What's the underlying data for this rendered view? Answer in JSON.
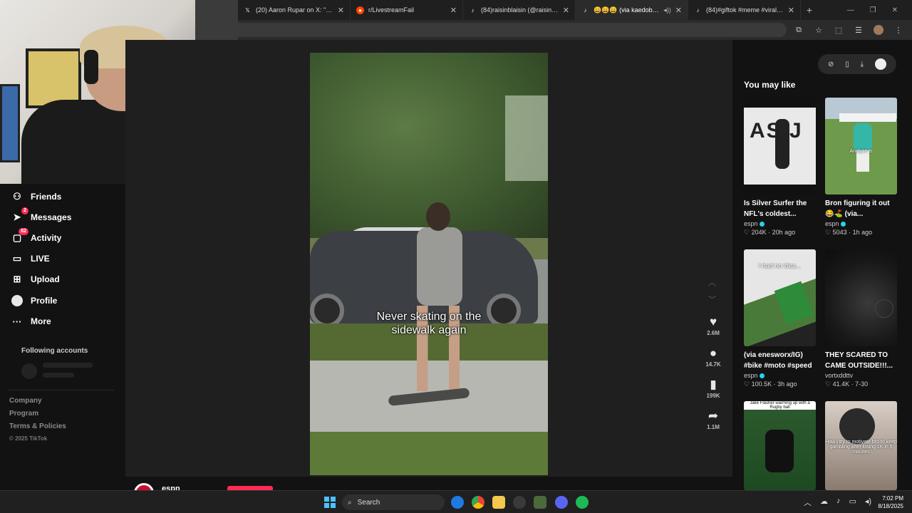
{
  "browser": {
    "tabs": [
      {
        "title": "(20) Aaron Rupar on X: \"Trump",
        "favicon": "x-logo-icon",
        "active": false
      },
      {
        "title": "r/LivestreamFail",
        "favicon": "reddit-icon",
        "active": false
      },
      {
        "title": "(84)raisinblaisin (@raisinblaisin",
        "favicon": "tiktok-icon",
        "active": false
      },
      {
        "title": "😄😄😄 (via kaedobrien/I",
        "favicon": "tiktok-icon",
        "active": true
      },
      {
        "title": "(84)#giftok #meme #viral #fun",
        "favicon": "tiktok-icon",
        "active": false
      }
    ],
    "new_tab": "+",
    "close_glyph": "✕"
  },
  "sidebar": {
    "items": [
      {
        "label": "Friends",
        "icon": "friends-icon"
      },
      {
        "label": "Messages",
        "icon": "messages-icon",
        "badge": "2"
      },
      {
        "label": "Activity",
        "icon": "activity-icon",
        "badge": "82"
      },
      {
        "label": "LIVE",
        "icon": "live-icon"
      },
      {
        "label": "Upload",
        "icon": "upload-icon"
      },
      {
        "label": "Profile",
        "icon": "profile-icon"
      },
      {
        "label": "More",
        "icon": "more-icon"
      }
    ],
    "following_title": "Following accounts",
    "footer_links": [
      "Company",
      "Program",
      "Terms & Policies"
    ],
    "copyright": "© 2025 TikTok"
  },
  "video": {
    "caption_line1": "Never skating on the",
    "caption_line2": "sidewalk again",
    "likes": "2.6M",
    "comments": "14.7K",
    "saves": "199K",
    "shares": "1.1M"
  },
  "bottom": {
    "author": "espn"
  },
  "recommendations": {
    "title": "You may like",
    "cards": [
      {
        "title": "Is Silver Surfer the NFL's coldest...",
        "author": "espn",
        "verified": true,
        "likes": "204K",
        "age": "20h ago",
        "overlay": ""
      },
      {
        "title": "Bron figuring it out 😂⛳ (via...",
        "author": "espn",
        "verified": true,
        "likes": "5043",
        "age": "1h ago",
        "overlay": "Analyze ts"
      },
      {
        "title": "(via enesworx/IG) #bike #moto #speed",
        "author": "espn",
        "verified": true,
        "likes": "100.5K",
        "age": "3h ago",
        "overlay": "I had no idea..."
      },
      {
        "title": "THEY SCARED TO CAME OUTSIDE!!!...",
        "author": "vortxddttv",
        "verified": false,
        "likes": "41.4K",
        "age": "7-30",
        "overlay": ""
      },
      {
        "title": "",
        "author": "",
        "verified": false,
        "likes": "",
        "age": "",
        "overlay": "Jake Flasher warming up with a Rugby ball"
      },
      {
        "title": "",
        "author": "",
        "verified": false,
        "likes": "",
        "age": "",
        "overlay": "How I try to motivate bro to keep gambling after losing 1K in 5 minutes"
      }
    ]
  },
  "taskbar": {
    "search_label": "Search",
    "time": "7:02 PM",
    "date": "8/18/2025"
  },
  "colors": {
    "accent": "#fe2c55",
    "verified": "#20d5ec",
    "background": "#121212"
  }
}
